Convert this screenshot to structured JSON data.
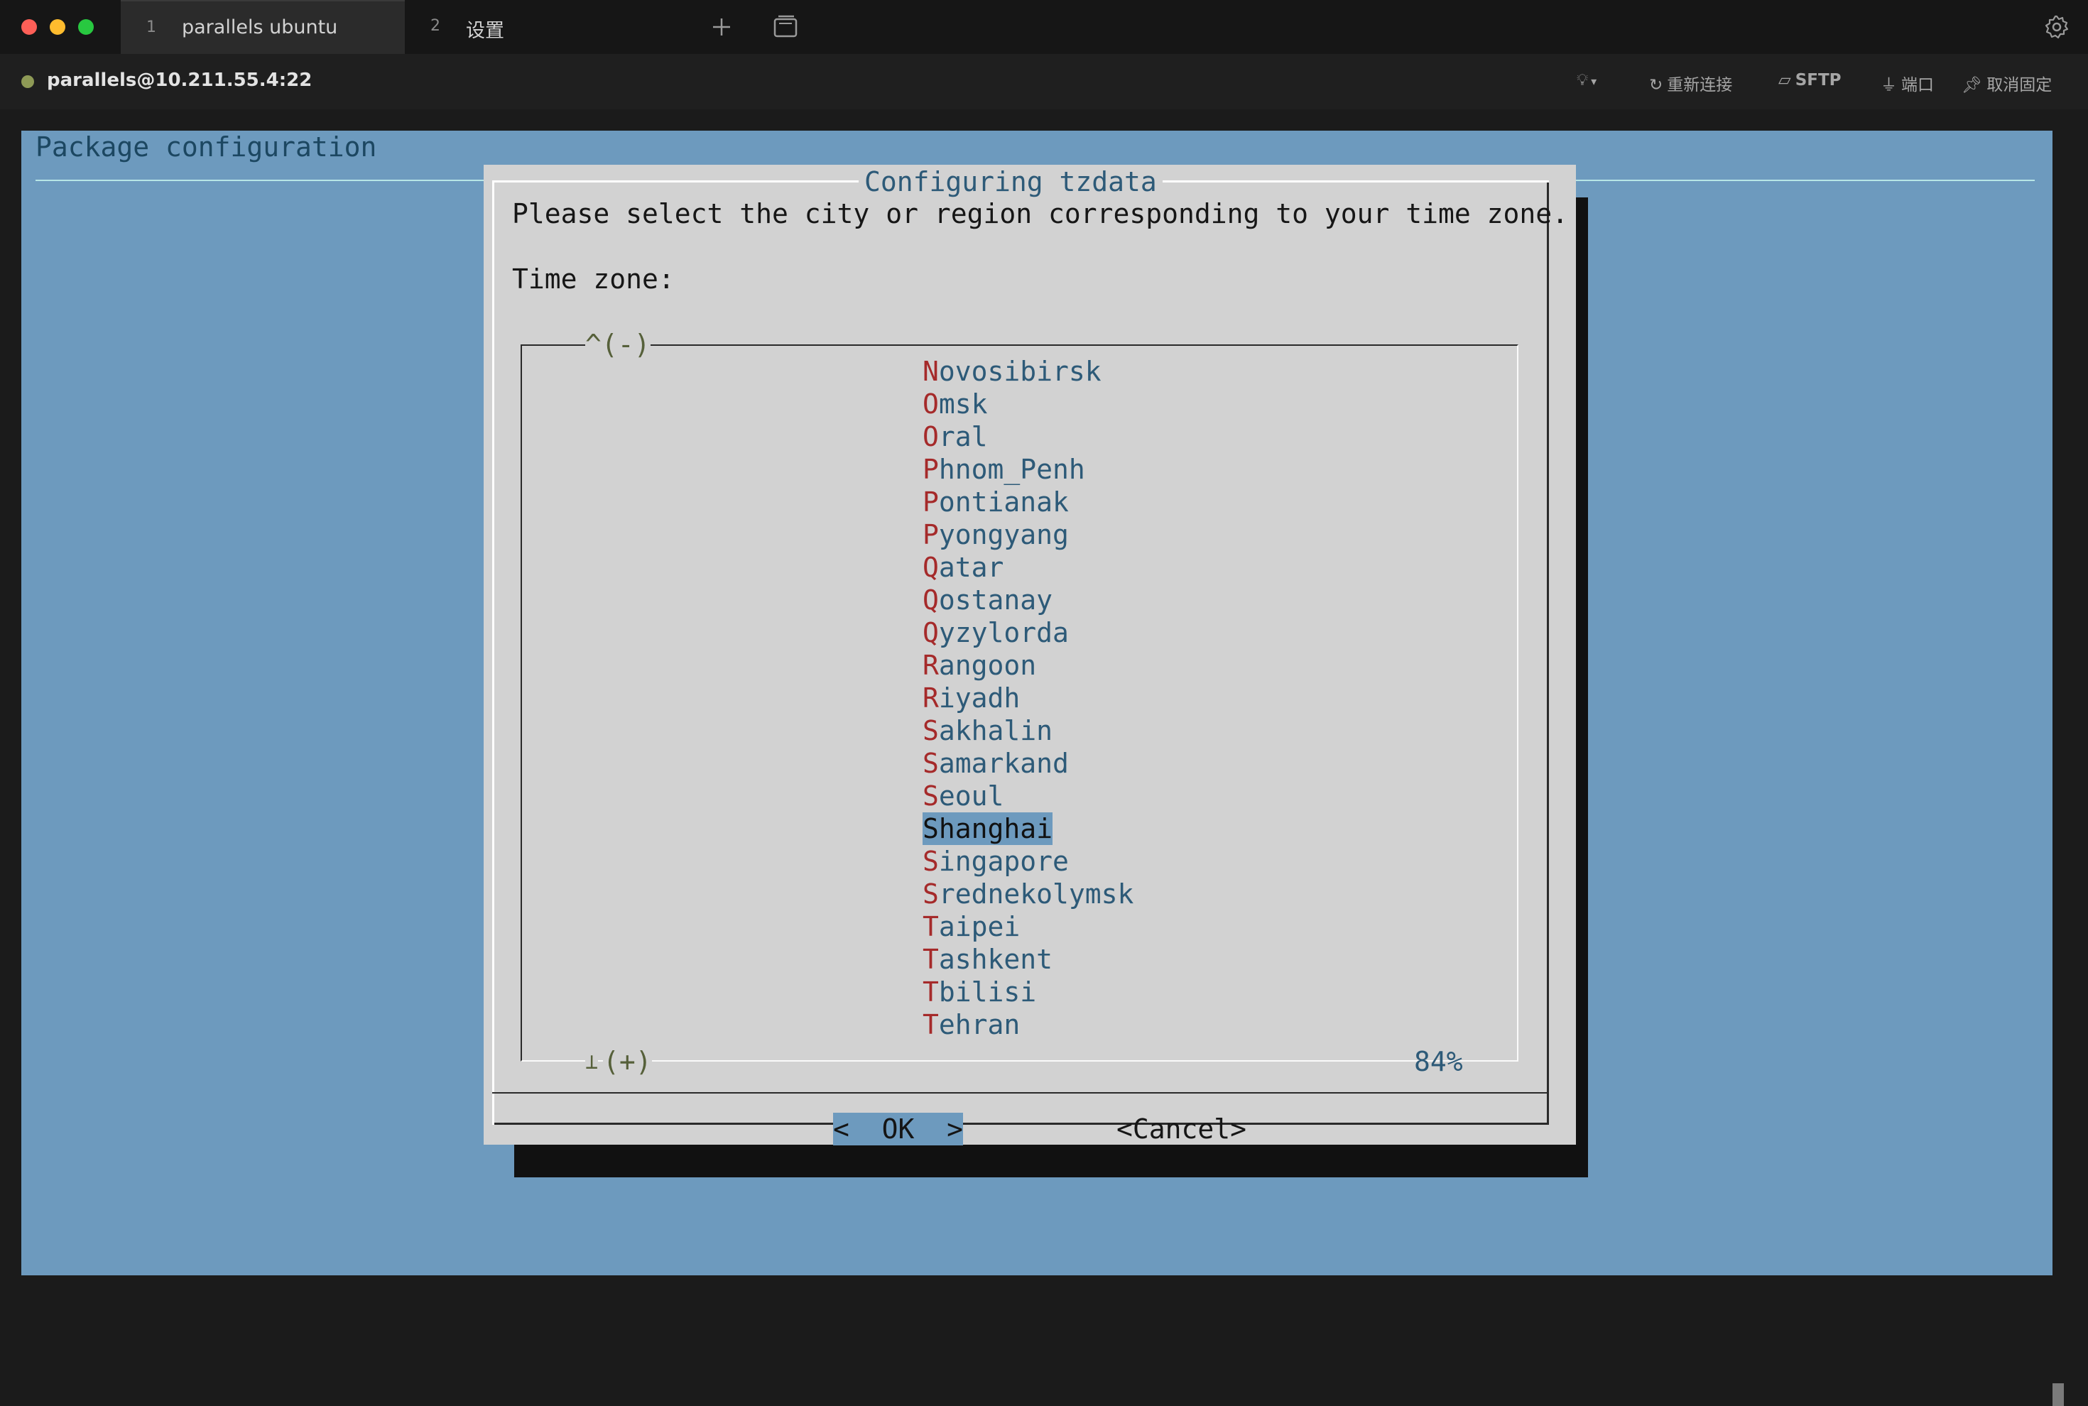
{
  "window": {
    "tabs": [
      {
        "num": "1",
        "title": "parallels ubuntu"
      },
      {
        "num": "2",
        "title": "设置"
      }
    ]
  },
  "session": {
    "host": "parallels@10.211.55.4:22",
    "actions": {
      "reconnect": "重新连接",
      "sftp": "SFTP",
      "port": "端口",
      "unpin": "取消固定"
    }
  },
  "terminal": {
    "header": "Package configuration",
    "dialog": {
      "title": "Configuring tzdata",
      "prompt": "Please select the city or region corresponding to your time zone.",
      "field_label": "Time zone:",
      "scroll_up_marker": "^(-)",
      "scroll_down_marker": "(+)",
      "scroll_percent": "84%",
      "items": [
        {
          "first": "N",
          "rest": "ovosibirsk"
        },
        {
          "first": "O",
          "rest": "msk"
        },
        {
          "first": "O",
          "rest": "ral"
        },
        {
          "first": "P",
          "rest": "hnom_Penh"
        },
        {
          "first": "P",
          "rest": "ontianak"
        },
        {
          "first": "P",
          "rest": "yongyang"
        },
        {
          "first": "Q",
          "rest": "atar"
        },
        {
          "first": "Q",
          "rest": "ostanay"
        },
        {
          "first": "Q",
          "rest": "yzylorda"
        },
        {
          "first": "R",
          "rest": "angoon"
        },
        {
          "first": "R",
          "rest": "iyadh"
        },
        {
          "first": "S",
          "rest": "akhalin"
        },
        {
          "first": "S",
          "rest": "amarkand"
        },
        {
          "first": "S",
          "rest": "eoul"
        },
        {
          "first": "S",
          "rest": "hanghai",
          "selected": true
        },
        {
          "first": "S",
          "rest": "ingapore"
        },
        {
          "first": "S",
          "rest": "rednekolymsk"
        },
        {
          "first": "T",
          "rest": "aipei"
        },
        {
          "first": "T",
          "rest": "ashkent"
        },
        {
          "first": "T",
          "rest": "bilisi"
        },
        {
          "first": "T",
          "rest": "ehran"
        }
      ],
      "buttons": {
        "ok": "<  OK  >",
        "cancel": "<Cancel>"
      }
    }
  },
  "colors": {
    "terminal_bg": "#6d9abe",
    "dialog_bg": "#d2d2d2",
    "hotkey": "#a52a2a",
    "item_text": "#2d5a78",
    "selection": "#6d9abe",
    "status_dot": "#8e9a56",
    "close": "#fe5f57",
    "minimize": "#febc2e",
    "zoom": "#28c840"
  }
}
